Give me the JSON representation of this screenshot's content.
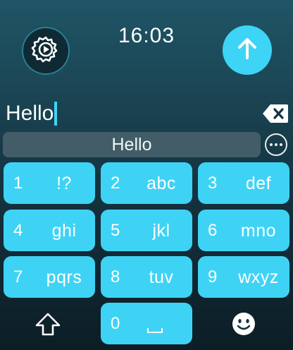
{
  "status": {
    "time": "16:03"
  },
  "toolbar": {
    "settings_icon": "gear-play-icon",
    "send_icon": "arrow-up-icon"
  },
  "text_input": {
    "value": "Hello",
    "backspace_icon": "backspace-icon"
  },
  "suggestions": {
    "items": [
      "Hello"
    ],
    "more_icon": "ellipsis-circle-icon"
  },
  "keypad": {
    "keys": [
      {
        "number": "1",
        "letters": "!?"
      },
      {
        "number": "2",
        "letters": "abc"
      },
      {
        "number": "3",
        "letters": "def"
      },
      {
        "number": "4",
        "letters": "ghi"
      },
      {
        "number": "5",
        "letters": "jkl"
      },
      {
        "number": "6",
        "letters": "mno"
      },
      {
        "number": "7",
        "letters": "pqrs"
      },
      {
        "number": "8",
        "letters": "tuv"
      },
      {
        "number": "9",
        "letters": "wxyz"
      },
      {
        "number": "0",
        "letters": "",
        "icon": "space-icon"
      }
    ],
    "shift_icon": "shift-icon",
    "emoji_icon": "emoji-icon"
  },
  "colors": {
    "accent": "#3ed3f5",
    "suggestion_bg": "#425d67",
    "background_top": "#1f5566",
    "background_bottom": "#0c1d25"
  }
}
